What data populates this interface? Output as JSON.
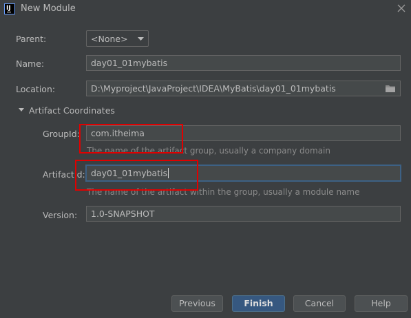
{
  "window": {
    "title": "New Module"
  },
  "form": {
    "parent": {
      "label": "Parent:",
      "value": "<None>"
    },
    "name": {
      "label": "Name:",
      "value": "day01_01mybatis"
    },
    "location": {
      "label": "Location:",
      "value": "D:\\Myproject\\JavaProject\\IDEA\\MyBatis\\day01_01mybatis"
    },
    "section_title": "Artifact Coordinates",
    "group_id": {
      "label": "GroupId:",
      "value": "com.itheima",
      "hint": "The name of the artifact group, usually a company domain"
    },
    "artifact_id": {
      "label": "ArtifactId:",
      "value": "day01_01mybatis",
      "hint": "The name of the artifact within the group, usually a module name"
    },
    "version": {
      "label": "Version:",
      "value": "1.0-SNAPSHOT"
    }
  },
  "buttons": {
    "previous": "Previous",
    "finish": "Finish",
    "cancel": "Cancel",
    "help": "Help"
  },
  "colors": {
    "background": "#3c3f41",
    "field_bg": "#45494a",
    "focus_border": "#3d6185",
    "primary_button": "#365880",
    "annotation_red": "#e10000"
  },
  "icons": [
    "intellij-app-icon",
    "close-icon",
    "chevron-down-icon",
    "folder-icon",
    "expand-triangle-icon"
  ]
}
